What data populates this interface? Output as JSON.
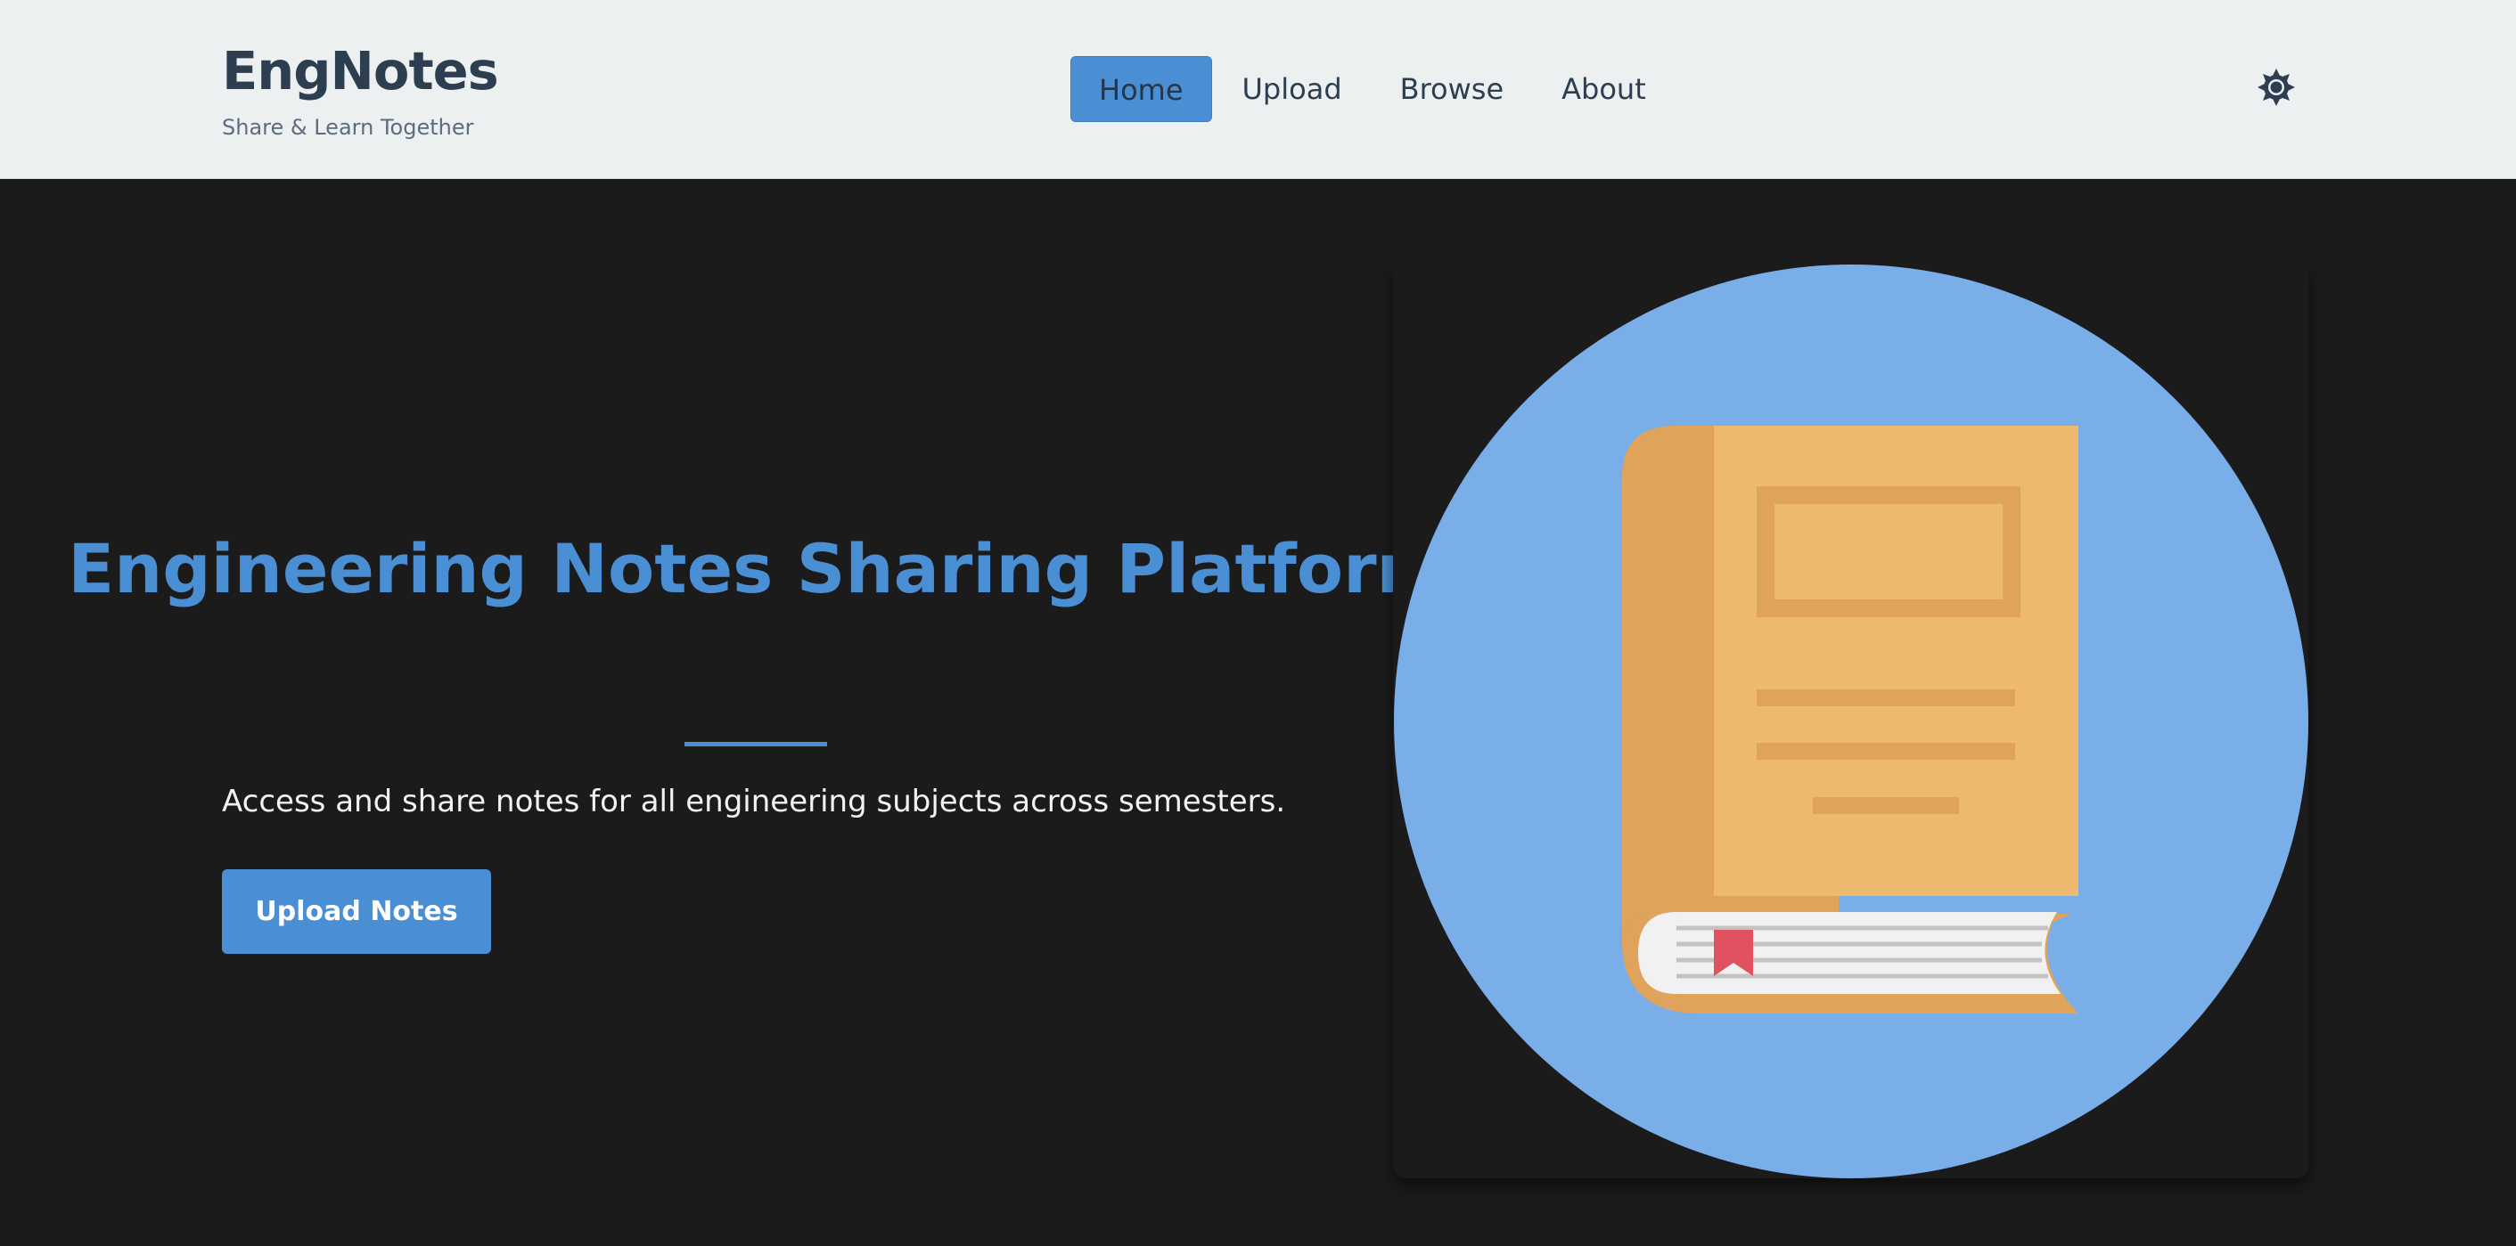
{
  "header": {
    "brand_title": "EngNotes",
    "brand_subtitle": "Share & Learn Together",
    "nav": [
      {
        "label": "Home",
        "active": true
      },
      {
        "label": "Upload",
        "active": false
      },
      {
        "label": "Browse",
        "active": false
      },
      {
        "label": "About",
        "active": false
      }
    ],
    "theme_icon": "sun-icon"
  },
  "hero": {
    "title": "Engineering Notes Sharing Platform",
    "description": "Access and share notes for all engineering subjects across semesters.",
    "cta_label": "Upload Notes",
    "illustration": "book-icon"
  },
  "colors": {
    "accent": "#4a8fd4",
    "header_bg": "#ecf0f1",
    "page_bg": "#1b1b1c",
    "brand_text": "#2c3e50",
    "circle": "#7aaee8",
    "book_cover": "#edb96f",
    "book_spine": "#dfa35b",
    "bookmark": "#e0525f"
  }
}
